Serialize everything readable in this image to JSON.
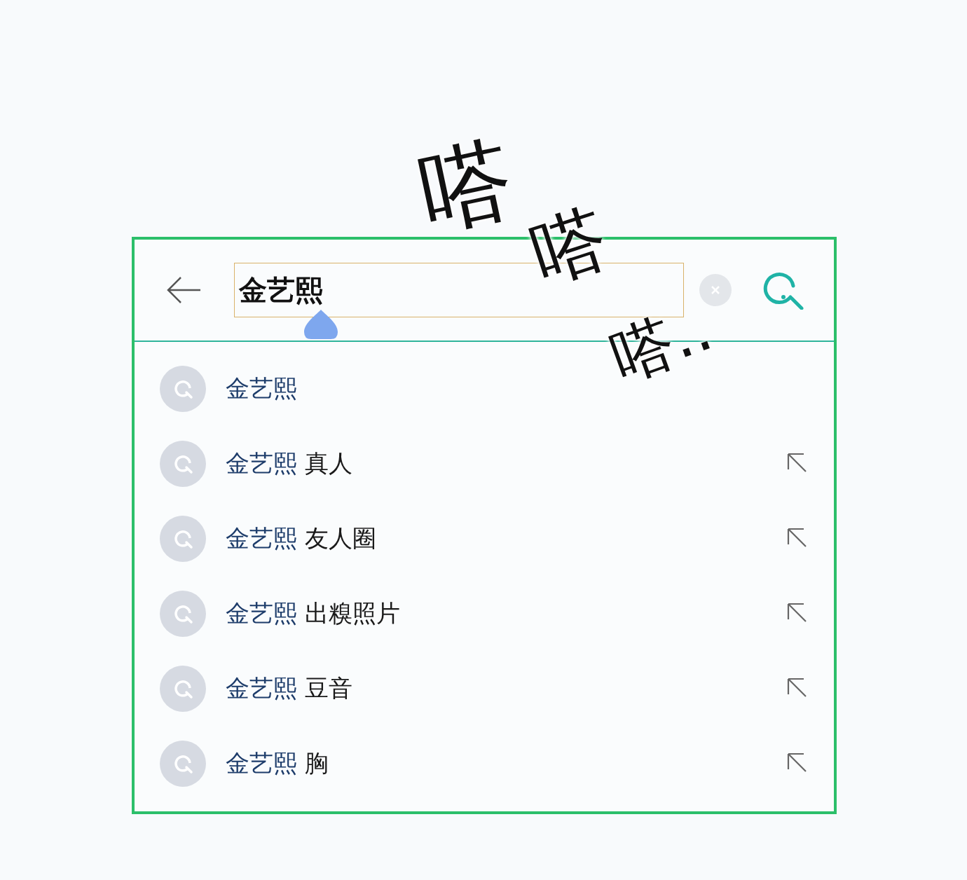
{
  "search_bar": {
    "value": "金艺熙"
  },
  "suggestions": [
    {
      "match": "金艺熙",
      "fill_arrow": false
    },
    {
      "match": "金艺熙",
      "rest": "真人",
      "fill_arrow": true
    },
    {
      "match": "金艺熙",
      "rest": "友人圈",
      "fill_arrow": true
    },
    {
      "match": "金艺熙",
      "rest": "出糗照片",
      "fill_arrow": true
    },
    {
      "match": "金艺熙",
      "rest": "豆音",
      "fill_arrow": true
    },
    {
      "match": "金艺熙",
      "rest": "胸",
      "fill_arrow": true
    }
  ],
  "sound_effect": [
    "嗒",
    "嗒",
    "嗒.."
  ]
}
